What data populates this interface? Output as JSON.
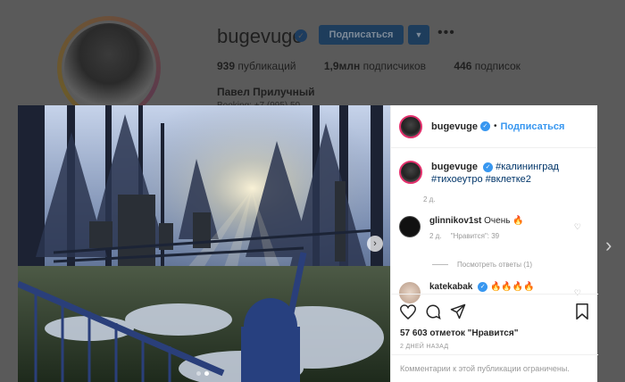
{
  "profile": {
    "username": "bugevuge",
    "follow_label": "Подписаться",
    "dropdown_glyph": "▼",
    "more_glyph": "•••",
    "posts_count": "939",
    "posts_label": "публикаций",
    "followers_count": "1,9млн",
    "followers_label": "подписчиков",
    "following_count": "446",
    "following_label": "подписок",
    "full_name": "Павел Прилучный",
    "bio_partial": "Booking: +7 (995) 50..."
  },
  "post": {
    "author": "bugevuge",
    "dot": "•",
    "follow_label": "Подписаться",
    "caption_user": "bugevuge",
    "caption_tags": "#калининград #тихоеутро #вклетке2",
    "caption_time": "2 д.",
    "comments": [
      {
        "user": "glinnikov1st",
        "text": "Очень 🔥",
        "time": "2 д.",
        "likes": "\"Нравится\": 39"
      },
      {
        "user": "katekabak",
        "text": "🔥🔥🔥🔥"
      }
    ],
    "view_replies": "Посмотреть ответы (1)",
    "likes_text": "57 603 отметок \"Нравится\"",
    "date_text": "2 ДНЕЙ НАЗАД",
    "comments_limited": "Комментарии к этой публикации ограничены."
  },
  "icons": {
    "verified": "✓",
    "photo_next": "›",
    "page_next": "›",
    "heart_small": "♡"
  },
  "colors": {
    "accent_blue": "#3897f0",
    "story_ring": "#e2306c",
    "backdrop": "#4f4f4f"
  }
}
